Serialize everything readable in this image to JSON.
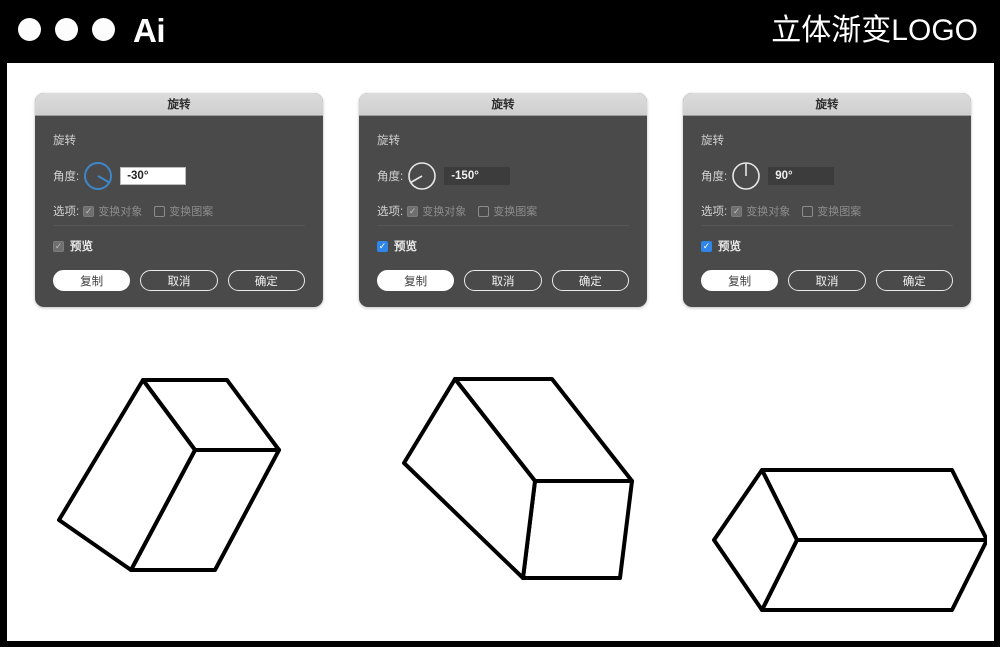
{
  "header": {
    "app_logo": "Ai",
    "title": "立体渐变LOGO",
    "window_dots": [
      "dot-1",
      "dot-2",
      "dot-3"
    ],
    "background_color": "#000000",
    "text_color": "#ffffff"
  },
  "canvas": {
    "background_color": "#ffffff",
    "border_color": "#000000"
  },
  "dialogs": [
    {
      "title": "旋转",
      "group_label": "旋转",
      "angle_label": "角度:",
      "angle_value": "-30°",
      "angle_degrees": -30,
      "angle_field_state": "active",
      "dial_color": "#3f86c8",
      "options_label": "选项:",
      "options": [
        {
          "label": "变换对象",
          "checked": true,
          "style": "gray-checked"
        },
        {
          "label": "变换图案",
          "checked": false,
          "style": "empty"
        }
      ],
      "preview_label": "预览",
      "preview_checked": true,
      "preview_style": "gray-checked",
      "buttons": [
        {
          "label": "复制",
          "style": "primary"
        },
        {
          "label": "取消",
          "style": "ghost"
        },
        {
          "label": "确定",
          "style": "ghost"
        }
      ]
    },
    {
      "title": "旋转",
      "group_label": "旋转",
      "angle_label": "角度:",
      "angle_value": "-150°",
      "angle_degrees": -150,
      "angle_field_state": "idle",
      "dial_color": "#e6e6e6",
      "options_label": "选项:",
      "options": [
        {
          "label": "变换对象",
          "checked": true,
          "style": "gray-checked"
        },
        {
          "label": "变换图案",
          "checked": false,
          "style": "empty"
        }
      ],
      "preview_label": "预览",
      "preview_checked": true,
      "preview_style": "blue-checked",
      "buttons": [
        {
          "label": "复制",
          "style": "primary"
        },
        {
          "label": "取消",
          "style": "ghost"
        },
        {
          "label": "确定",
          "style": "ghost"
        }
      ]
    },
    {
      "title": "旋转",
      "group_label": "旋转",
      "angle_label": "角度:",
      "angle_value": "90°",
      "angle_degrees": 90,
      "angle_field_state": "idle",
      "dial_color": "#e6e6e6",
      "options_label": "选项:",
      "options": [
        {
          "label": "变换对象",
          "checked": true,
          "style": "gray-checked"
        },
        {
          "label": "变换图案",
          "checked": false,
          "style": "empty"
        }
      ],
      "preview_label": "预览",
      "preview_checked": true,
      "preview_style": "blue-checked",
      "buttons": [
        {
          "label": "复制",
          "style": "primary"
        },
        {
          "label": "取消",
          "style": "ghost"
        },
        {
          "label": "确定",
          "style": "ghost"
        }
      ]
    }
  ],
  "shapes": {
    "stroke_color": "#000000",
    "fill_color": "#ffffff",
    "stroke_width": 4,
    "items": [
      {
        "name": "isometric-box-rotated--30",
        "related_angle": "-30°"
      },
      {
        "name": "isometric-box-rotated--150",
        "related_angle": "-150°"
      },
      {
        "name": "isometric-box-rotated-90",
        "related_angle": "90°"
      }
    ]
  }
}
